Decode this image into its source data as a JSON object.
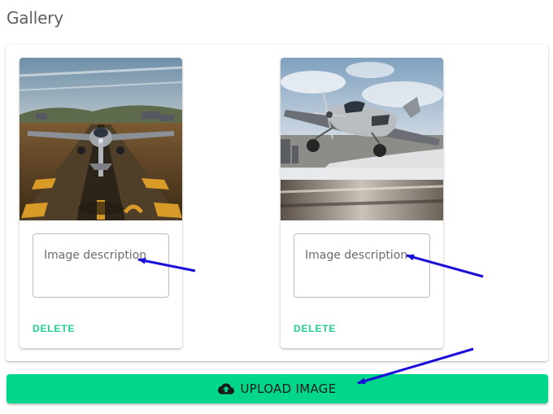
{
  "page": {
    "title": "Gallery"
  },
  "gallery": {
    "cards": [
      {
        "image_subject": "propeller airplane on runway, front view",
        "description_placeholder": "Image description",
        "description_value": "",
        "delete_label": "DELETE"
      },
      {
        "image_subject": "propeller airplane taking off, side view",
        "description_placeholder": "Image description",
        "description_value": "",
        "delete_label": "DELETE"
      }
    ]
  },
  "upload": {
    "label": "UPLOAD IMAGE",
    "icon": "cloud-upload-icon"
  },
  "colors": {
    "accent": "#02d68a",
    "delete_text": "#1fd18c",
    "annotation_arrow": "#1a0fd8",
    "title_text": "#5f5f5f"
  }
}
